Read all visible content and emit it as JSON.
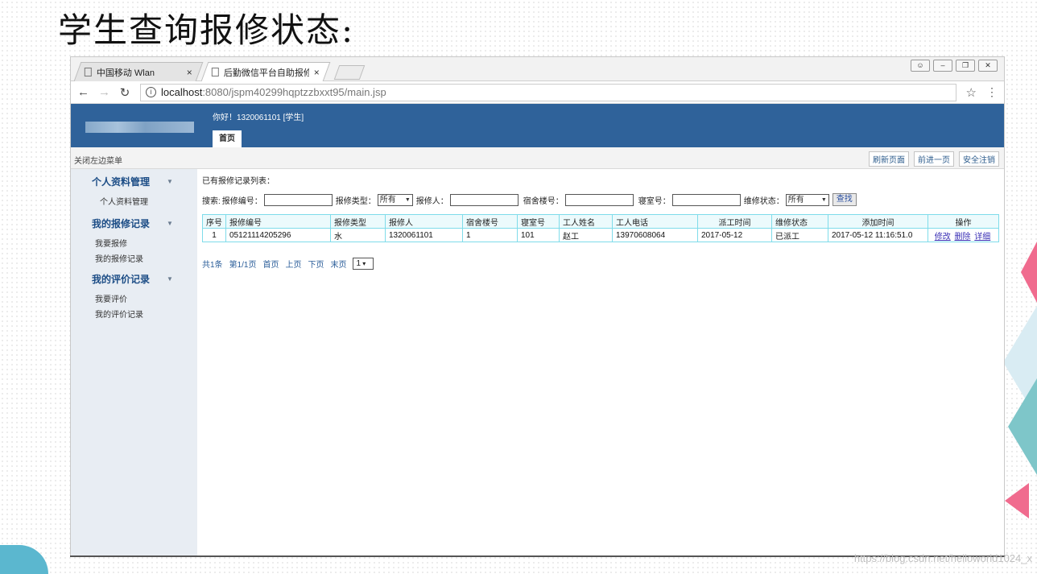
{
  "slide": {
    "title": "学生查询报修状态:",
    "watermark": "https://blog.csdn.net/helloworld1024_x"
  },
  "browser": {
    "tabs": [
      {
        "label": "中国移动 Wlan",
        "active": false
      },
      {
        "label": "后勤微信平台自助报修系",
        "active": true
      }
    ],
    "window_controls": [
      "person",
      "minimize",
      "restore",
      "close"
    ],
    "url_host": "localhost",
    "url_rest": ":8080/jspm40299hqptzzbxxt95/main.jsp"
  },
  "app": {
    "greeting": "你好！1320061101 [学生]",
    "home_tab": "首页",
    "collapse_menu": "关闭左边菜单",
    "toolbar": [
      "刷新页面",
      "前进一页",
      "安全注销"
    ]
  },
  "sidebar": {
    "groups": [
      {
        "title": "个人资料管理",
        "items": [
          "个人资料管理"
        ]
      },
      {
        "title": "我的报修记录",
        "items": [
          "我要报修",
          "我的报修记录"
        ]
      },
      {
        "title": "我的评价记录",
        "items": [
          "我要评价",
          "我的评价记录"
        ]
      }
    ]
  },
  "content": {
    "list_title": "已有报修记录列表：",
    "search": {
      "prefix": "搜索:",
      "f1": "报修编号：",
      "f2": "报修类型：",
      "f2_value": "所有",
      "f3": "报修人：",
      "f4": "宿舍楼号：",
      "f5": "寝室号：",
      "f6": "维修状态：",
      "f6_value": "所有",
      "button": "查找"
    },
    "table": {
      "headers": [
        "序号",
        "报修编号",
        "报修类型",
        "报修人",
        "宿舍楼号",
        "寝室号",
        "工人姓名",
        "工人电话",
        "派工时间",
        "维修状态",
        "添加时间",
        "操作"
      ],
      "rows": [
        [
          "1",
          "05121114205296",
          "水",
          "1320061101",
          "1",
          "101",
          "赵工",
          "13970608064",
          "2017-05-12",
          "已派工",
          "2017-05-12 11:16:51.0"
        ]
      ],
      "ops": [
        "修改",
        "删除",
        "详细"
      ]
    },
    "pager": {
      "total": "共1条",
      "page": "第1/1页",
      "first": "首页",
      "prev": "上页",
      "next": "下页",
      "last": "末页",
      "select": "1"
    }
  }
}
